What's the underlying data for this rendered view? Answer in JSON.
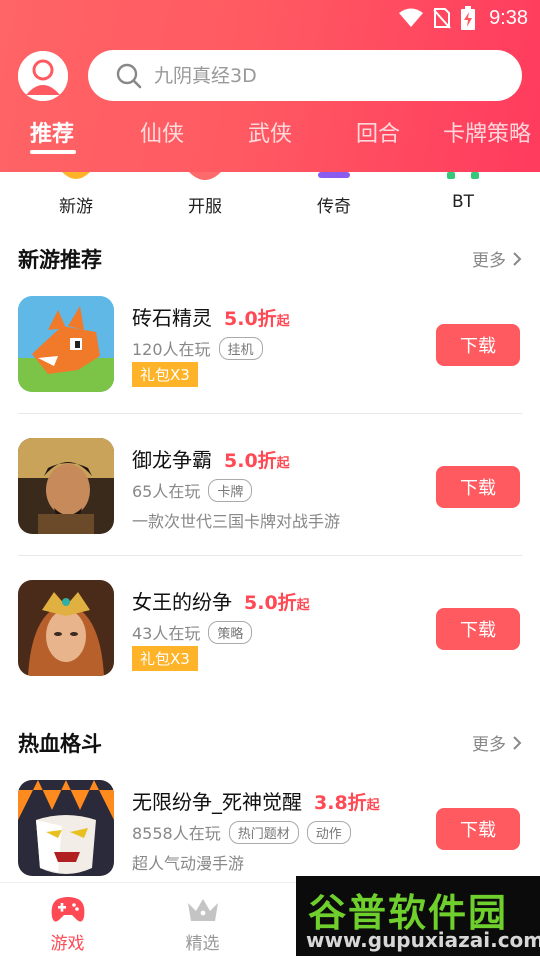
{
  "status": {
    "time": "9:38"
  },
  "search": {
    "placeholder": "九阴真经3D"
  },
  "tabs": [
    {
      "label": "推荐"
    },
    {
      "label": "仙侠"
    },
    {
      "label": "武侠"
    },
    {
      "label": "回合"
    },
    {
      "label": "卡牌策略"
    }
  ],
  "quick_entries": [
    {
      "label": "新游",
      "icon": "sun-icon"
    },
    {
      "label": "开服",
      "icon": "server-icon"
    },
    {
      "label": "传奇",
      "icon": "legend-icon"
    },
    {
      "label": "BT",
      "icon": "bt-icon"
    }
  ],
  "sections": [
    {
      "title": "新游推荐",
      "more": "更多"
    },
    {
      "title": "热血格斗",
      "more": "更多"
    }
  ],
  "games": [
    {
      "name": "砖石精灵",
      "discount": "5.0折",
      "discount_suffix": "起",
      "players": "120人在玩",
      "tags": [
        "挂机"
      ],
      "gift": "礼包X3",
      "desc": "",
      "button": "下载"
    },
    {
      "name": "御龙争霸",
      "discount": "5.0折",
      "discount_suffix": "起",
      "players": "65人在玩",
      "tags": [
        "卡牌"
      ],
      "gift": "",
      "desc": "一款次世代三国卡牌对战手游",
      "button": "下载"
    },
    {
      "name": "女王的纷争",
      "discount": "5.0折",
      "discount_suffix": "起",
      "players": "43人在玩",
      "tags": [
        "策略"
      ],
      "gift": "礼包X3",
      "desc": "",
      "button": "下载"
    },
    {
      "name": "无限纷争_死神觉醒",
      "discount": "3.8折",
      "discount_suffix": "起",
      "players": "8558人在玩",
      "tags": [
        "热门题材",
        "动作"
      ],
      "gift": "",
      "desc": "超人气动漫手游",
      "button": "下载"
    }
  ],
  "bottom_nav": [
    {
      "label": "游戏",
      "icon": "gamepad-icon",
      "active": true
    },
    {
      "label": "精选",
      "icon": "crown-icon",
      "active": false
    }
  ],
  "watermark": {
    "title": "谷普软件园",
    "url": "www.gupuxiazai.com"
  },
  "colors": {
    "header_start": "#ff6466",
    "header_end": "#ff3b5e",
    "accent": "#ff4a55",
    "gift": "#ffb329",
    "download": "#ff5a60"
  }
}
